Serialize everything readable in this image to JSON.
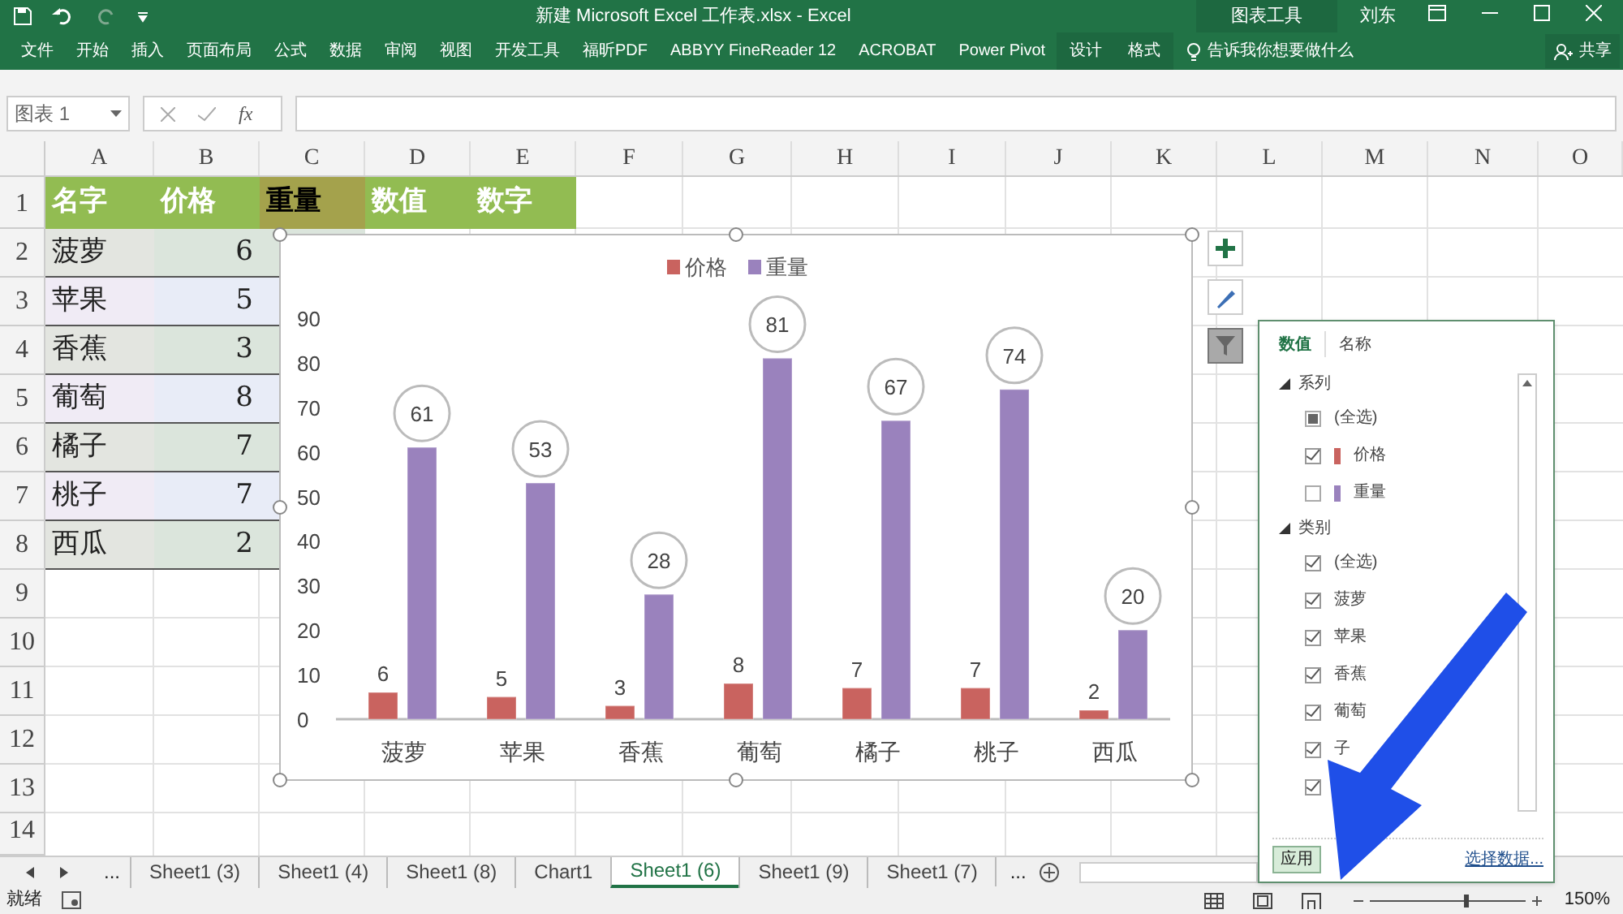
{
  "window": {
    "title": "新建 Microsoft Excel 工作表.xlsx  -  Excel",
    "context_tab": "图表工具",
    "user": "刘东"
  },
  "ribbon": {
    "tabs": [
      {
        "label": "文件",
        "contextual": false
      },
      {
        "label": "开始",
        "contextual": false
      },
      {
        "label": "插入",
        "contextual": false
      },
      {
        "label": "页面布局",
        "contextual": false
      },
      {
        "label": "公式",
        "contextual": false
      },
      {
        "label": "数据",
        "contextual": false
      },
      {
        "label": "审阅",
        "contextual": false
      },
      {
        "label": "视图",
        "contextual": false
      },
      {
        "label": "开发工具",
        "contextual": false
      },
      {
        "label": "福昕PDF",
        "contextual": false
      },
      {
        "label": "ABBYY FineReader 12",
        "contextual": false
      },
      {
        "label": "ACROBAT",
        "contextual": false
      },
      {
        "label": "Power Pivot",
        "contextual": false
      },
      {
        "label": "设计",
        "contextual": true
      },
      {
        "label": "格式",
        "contextual": true
      }
    ],
    "tell_me": "告诉我你想要做什么",
    "share": "共享"
  },
  "formula_bar": {
    "name_box": "图表 1",
    "fx": "fx"
  },
  "sheet": {
    "columns": [
      "A",
      "B",
      "C",
      "D",
      "E",
      "F",
      "G",
      "H",
      "I",
      "J",
      "K",
      "L",
      "M",
      "N",
      "O"
    ],
    "rows": [
      "1",
      "2",
      "3",
      "4",
      "5",
      "6",
      "7",
      "8",
      "9",
      "10",
      "11",
      "12",
      "13",
      "14"
    ],
    "header": [
      "名字",
      "价格",
      "重量",
      "数值",
      "数字"
    ],
    "data": [
      {
        "name": "菠萝",
        "price": "6"
      },
      {
        "name": "苹果",
        "price": "5"
      },
      {
        "name": "香蕉",
        "price": "3"
      },
      {
        "name": "葡萄",
        "price": "8"
      },
      {
        "name": "橘子",
        "price": "7"
      },
      {
        "name": "桃子",
        "price": "7"
      },
      {
        "name": "西瓜",
        "price": "2"
      }
    ]
  },
  "chart": {
    "chart_data": {
      "type": "bar",
      "categories": [
        "菠萝",
        "苹果",
        "香蕉",
        "葡萄",
        "橘子",
        "桃子",
        "西瓜"
      ],
      "series": [
        {
          "name": "价格",
          "color": "#c9635f",
          "values": [
            6,
            5,
            3,
            8,
            7,
            7,
            2
          ]
        },
        {
          "name": "重量",
          "color": "#9a82bd",
          "values": [
            61,
            53,
            28,
            81,
            67,
            74,
            20
          ]
        }
      ],
      "legend": "top",
      "ylim": [
        0,
        90
      ],
      "yticks": [
        0,
        10,
        20,
        30,
        40,
        50,
        60,
        70,
        80,
        90
      ],
      "data_labels": true
    }
  },
  "filter_panel": {
    "tabs": [
      {
        "label": "数值",
        "selected": true
      },
      {
        "label": "名称",
        "selected": false
      }
    ],
    "groups": [
      {
        "label": "系列",
        "expanded": true,
        "items": [
          {
            "label": "(全选)",
            "checked": false,
            "partial": true
          },
          {
            "label": "价格",
            "checked": true,
            "partial": false,
            "color": "#c9635f"
          },
          {
            "label": "重量",
            "checked": false,
            "partial": false,
            "color": "#9a82bd"
          }
        ]
      },
      {
        "label": "类别",
        "expanded": true,
        "items": [
          {
            "label": "(全选)",
            "checked": true,
            "partial": false
          },
          {
            "label": "菠萝",
            "checked": true,
            "partial": false
          },
          {
            "label": "苹果",
            "checked": true,
            "partial": false
          },
          {
            "label": "香蕉",
            "checked": true,
            "partial": false
          },
          {
            "label": "葡萄",
            "checked": true,
            "partial": false
          },
          {
            "label": "子",
            "checked": true,
            "partial": false
          },
          {
            "checked": true,
            "partial": false
          }
        ]
      }
    ],
    "apply": "应用",
    "select_data": "选择数据..."
  },
  "sheet_tabs": {
    "more_left": "...",
    "tabs": [
      {
        "label": "Sheet1 (3)",
        "selected": false
      },
      {
        "label": "Sheet1 (4)",
        "selected": false
      },
      {
        "label": "Sheet1 (8)",
        "selected": false
      },
      {
        "label": "Chart1",
        "selected": false
      },
      {
        "label": "Sheet1 (6)",
        "selected": true
      },
      {
        "label": "Sheet1 (9)",
        "selected": false
      },
      {
        "label": "Sheet1 (7)",
        "selected": false
      }
    ],
    "more_right": "..."
  },
  "status_bar": {
    "status": "就绪",
    "zoom_slider": {
      "level": 0.62
    },
    "zoom": "150%"
  }
}
